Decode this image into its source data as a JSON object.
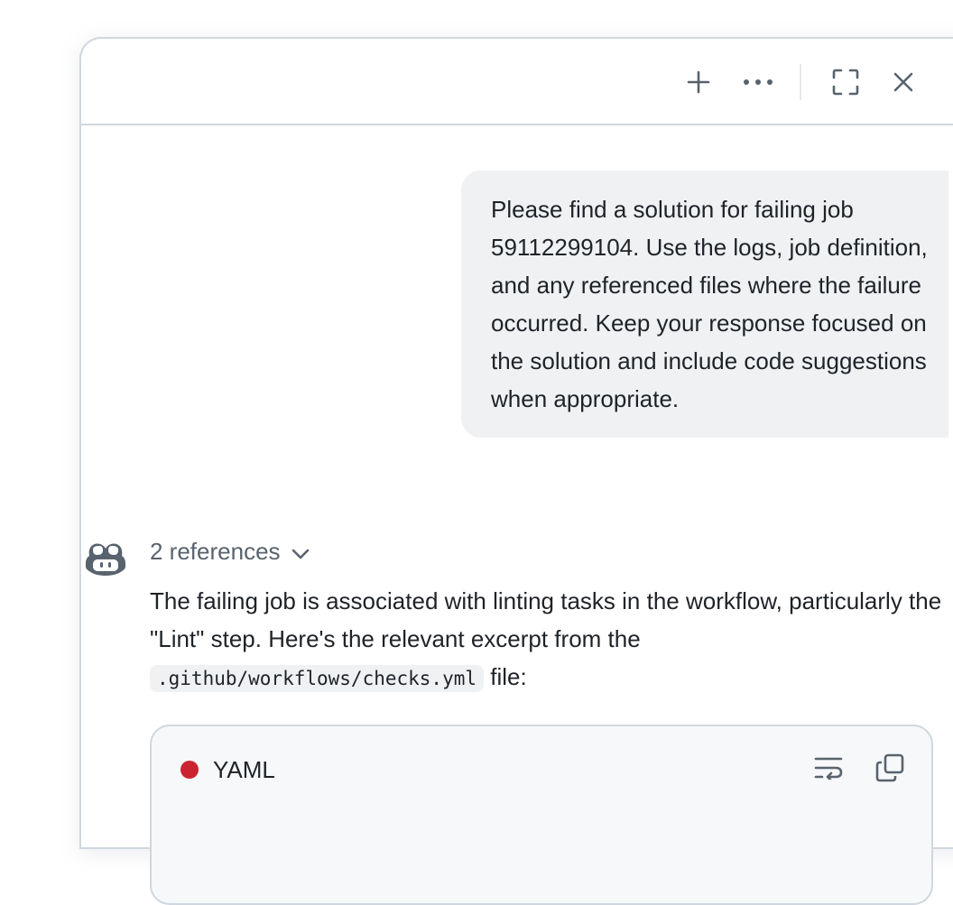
{
  "header": {
    "new_icon": "plus-icon",
    "more_icon": "kebab-horizontal-icon",
    "fullscreen_icon": "screen-full-icon",
    "close_icon": "x-icon"
  },
  "conversation": {
    "user_message": "Please find a solution for failing job 59112299104. Use the logs, job definition, and any referenced files where the failure occurred. Keep your response focused on the solution and include code suggestions when appropriate.",
    "assistant": {
      "avatar_icon": "copilot-icon",
      "references_label": "2 references",
      "references_icon": "chevron-down-icon",
      "answer_part1": "The failing job is associated with linting tasks in the workflow, particularly the \"Lint\" step. Here's the relevant excerpt from the",
      "answer_code": ".github/workflows/checks.yml",
      "answer_part2": "file:",
      "code_block": {
        "language": "YAML",
        "language_color": "#cb2431",
        "wrap_icon": "word-wrap-icon",
        "copy_icon": "copy-icon"
      }
    }
  }
}
